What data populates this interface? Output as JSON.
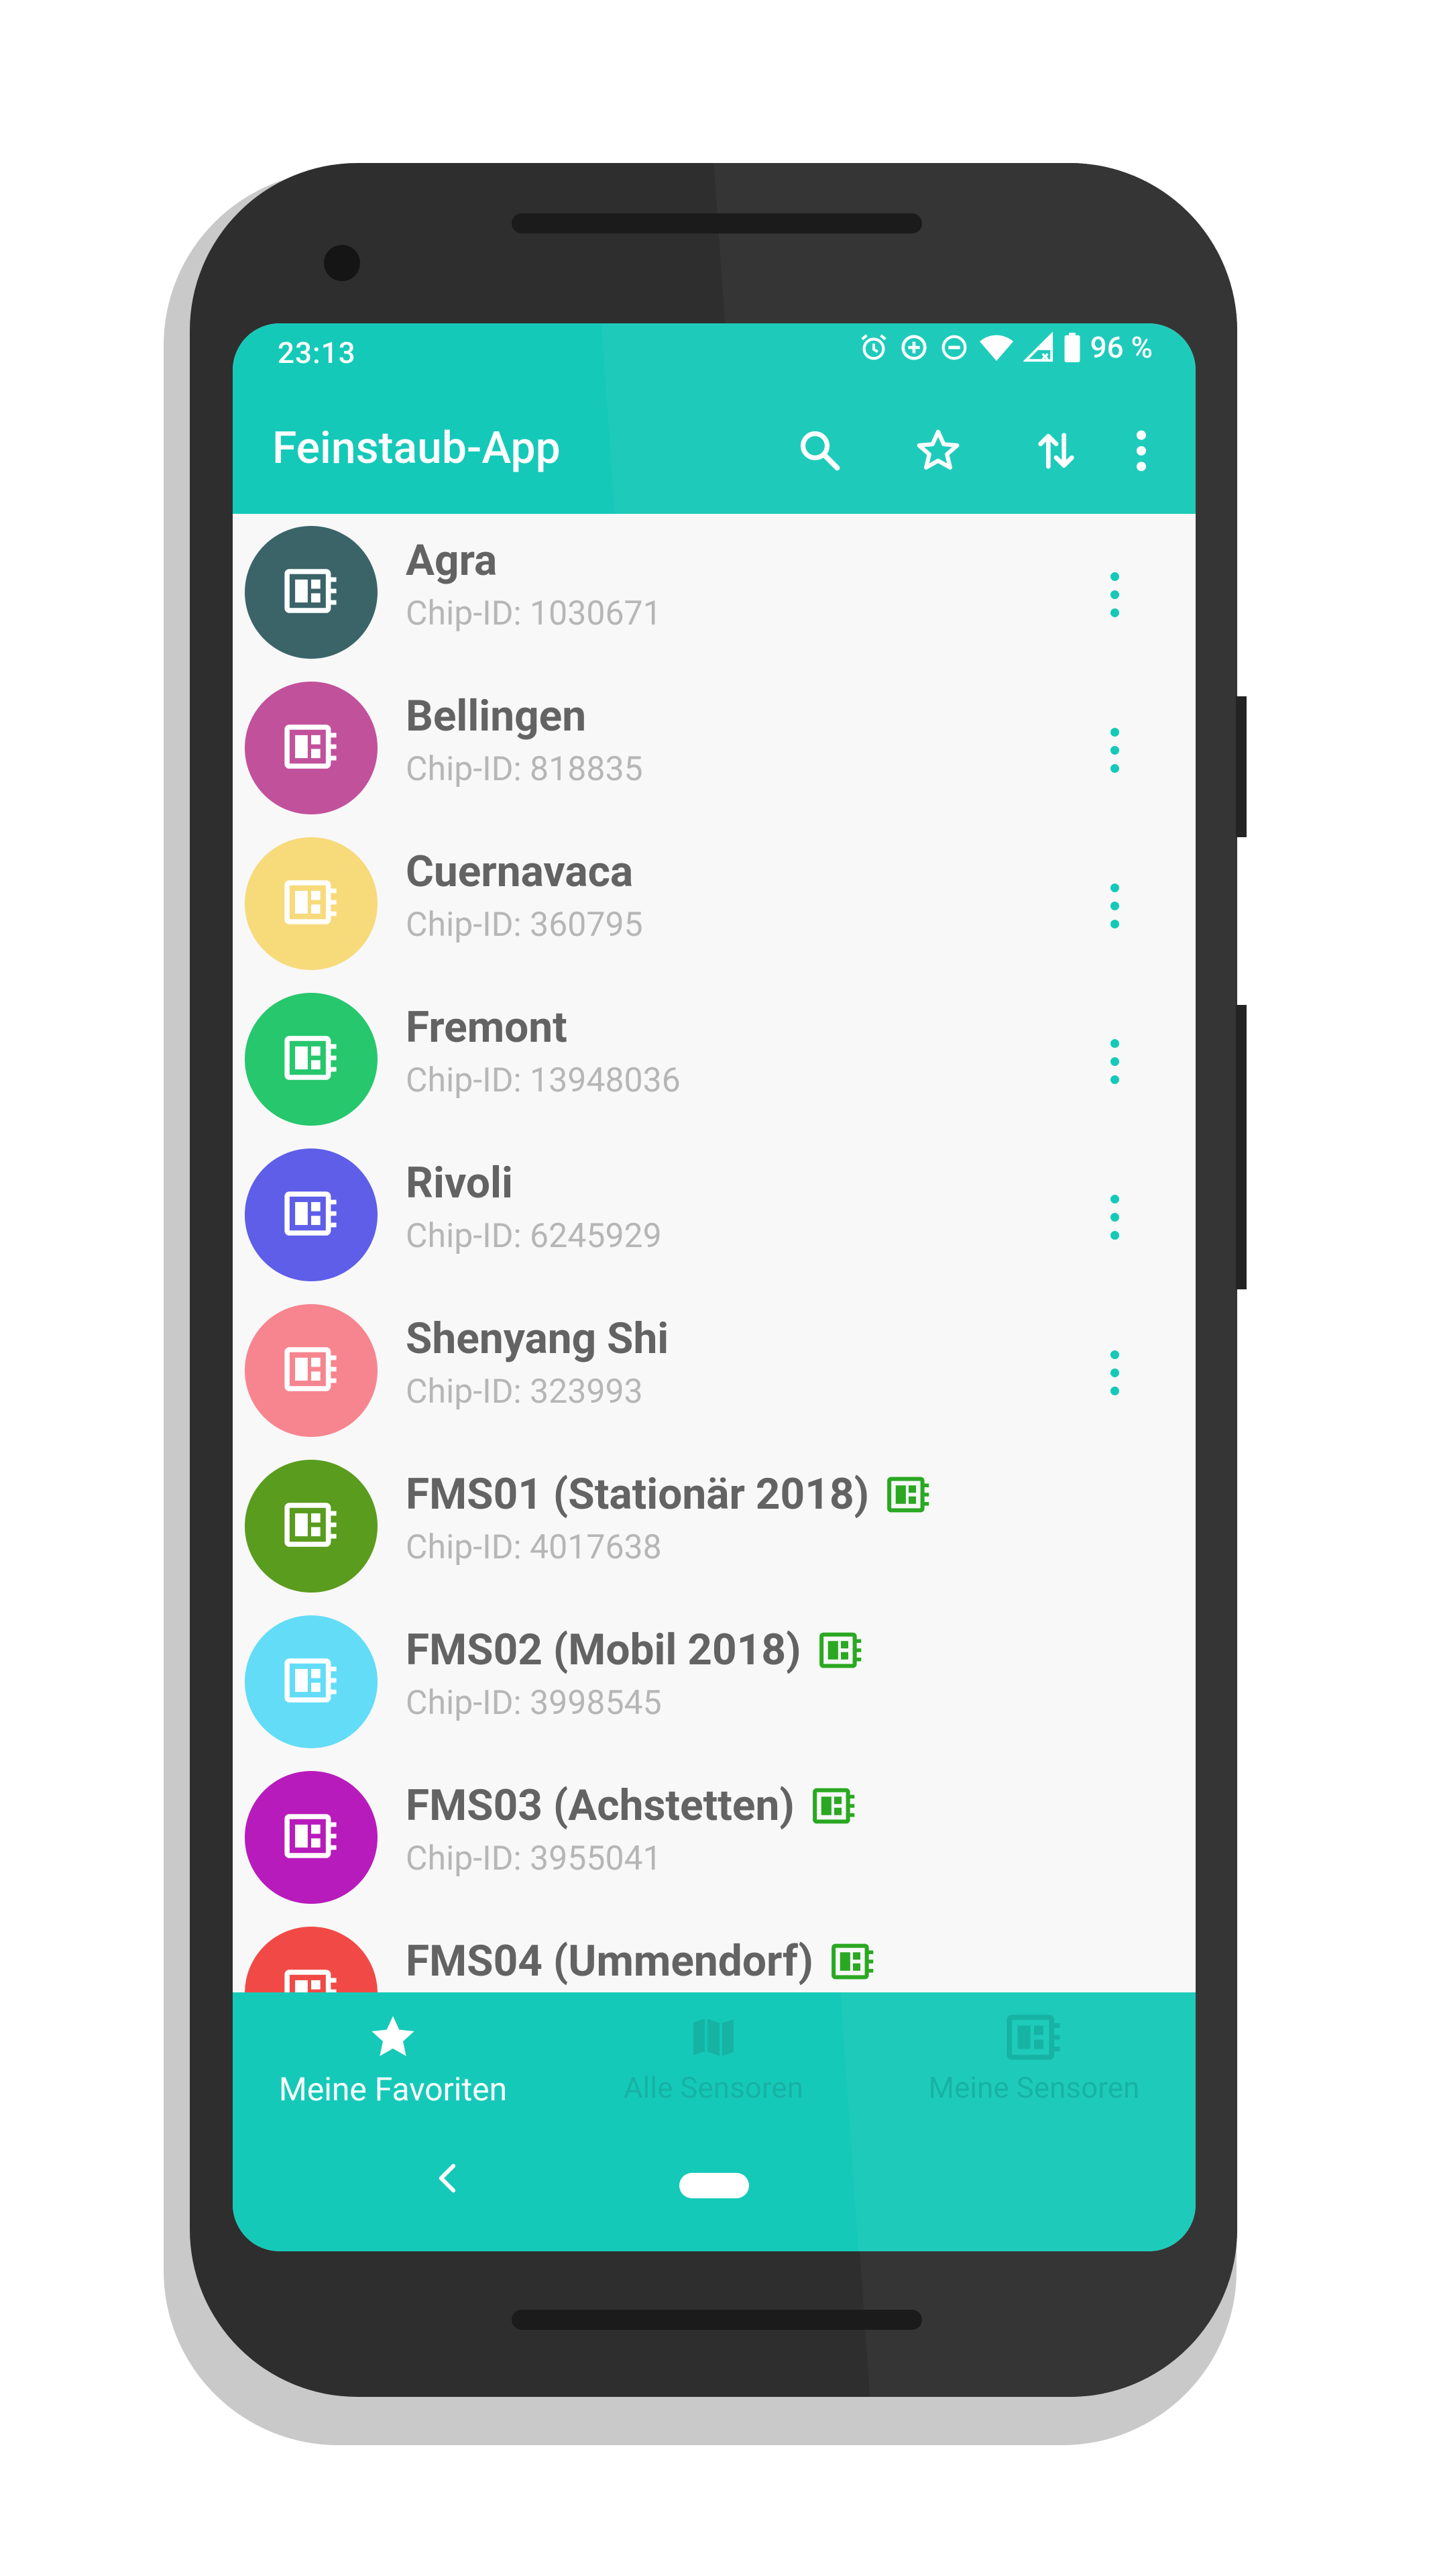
{
  "status_bar": {
    "time": "23:13",
    "battery_label": "96 %"
  },
  "app_bar": {
    "title": "Feinstaub-App"
  },
  "list": {
    "items": [
      {
        "name": "Agra",
        "chip_label": "Chip-ID: 1030671",
        "color": "#3b6469",
        "own_sensor": false
      },
      {
        "name": "Bellingen",
        "chip_label": "Chip-ID: 818835",
        "color": "#c2519c",
        "own_sensor": false
      },
      {
        "name": "Cuernavaca",
        "chip_label": "Chip-ID: 360795",
        "color": "#f7da7a",
        "own_sensor": false
      },
      {
        "name": "Fremont",
        "chip_label": "Chip-ID: 13948036",
        "color": "#26c76d",
        "own_sensor": false
      },
      {
        "name": "Rivoli",
        "chip_label": "Chip-ID: 6245929",
        "color": "#5e5ee8",
        "own_sensor": false
      },
      {
        "name": "Shenyang Shi",
        "chip_label": "Chip-ID: 323993",
        "color": "#f7858f",
        "own_sensor": false
      },
      {
        "name": "FMS01 (Stationär 2018)",
        "chip_label": "Chip-ID: 4017638",
        "color": "#5a9c1e",
        "own_sensor": true
      },
      {
        "name": "FMS02 (Mobil 2018)",
        "chip_label": "Chip-ID: 3998545",
        "color": "#63dcf7",
        "own_sensor": true
      },
      {
        "name": "FMS03 (Achstetten)",
        "chip_label": "Chip-ID: 3955041",
        "color": "#b81bbb",
        "own_sensor": true
      },
      {
        "name": "FMS04 (Ummendorf)",
        "chip_label": "",
        "color": "#f14a46",
        "own_sensor": true
      }
    ]
  },
  "bottom_nav": {
    "items": [
      {
        "label": "Meine Favoriten",
        "icon": "star-icon",
        "active": true
      },
      {
        "label": "Alle Sensoren",
        "icon": "map-icon",
        "active": false
      },
      {
        "label": "Meine Sensoren",
        "icon": "sensor-icon",
        "active": false
      }
    ]
  },
  "colors": {
    "accent": "#15c9b9",
    "own_sensor_badge": "#2aa822"
  }
}
